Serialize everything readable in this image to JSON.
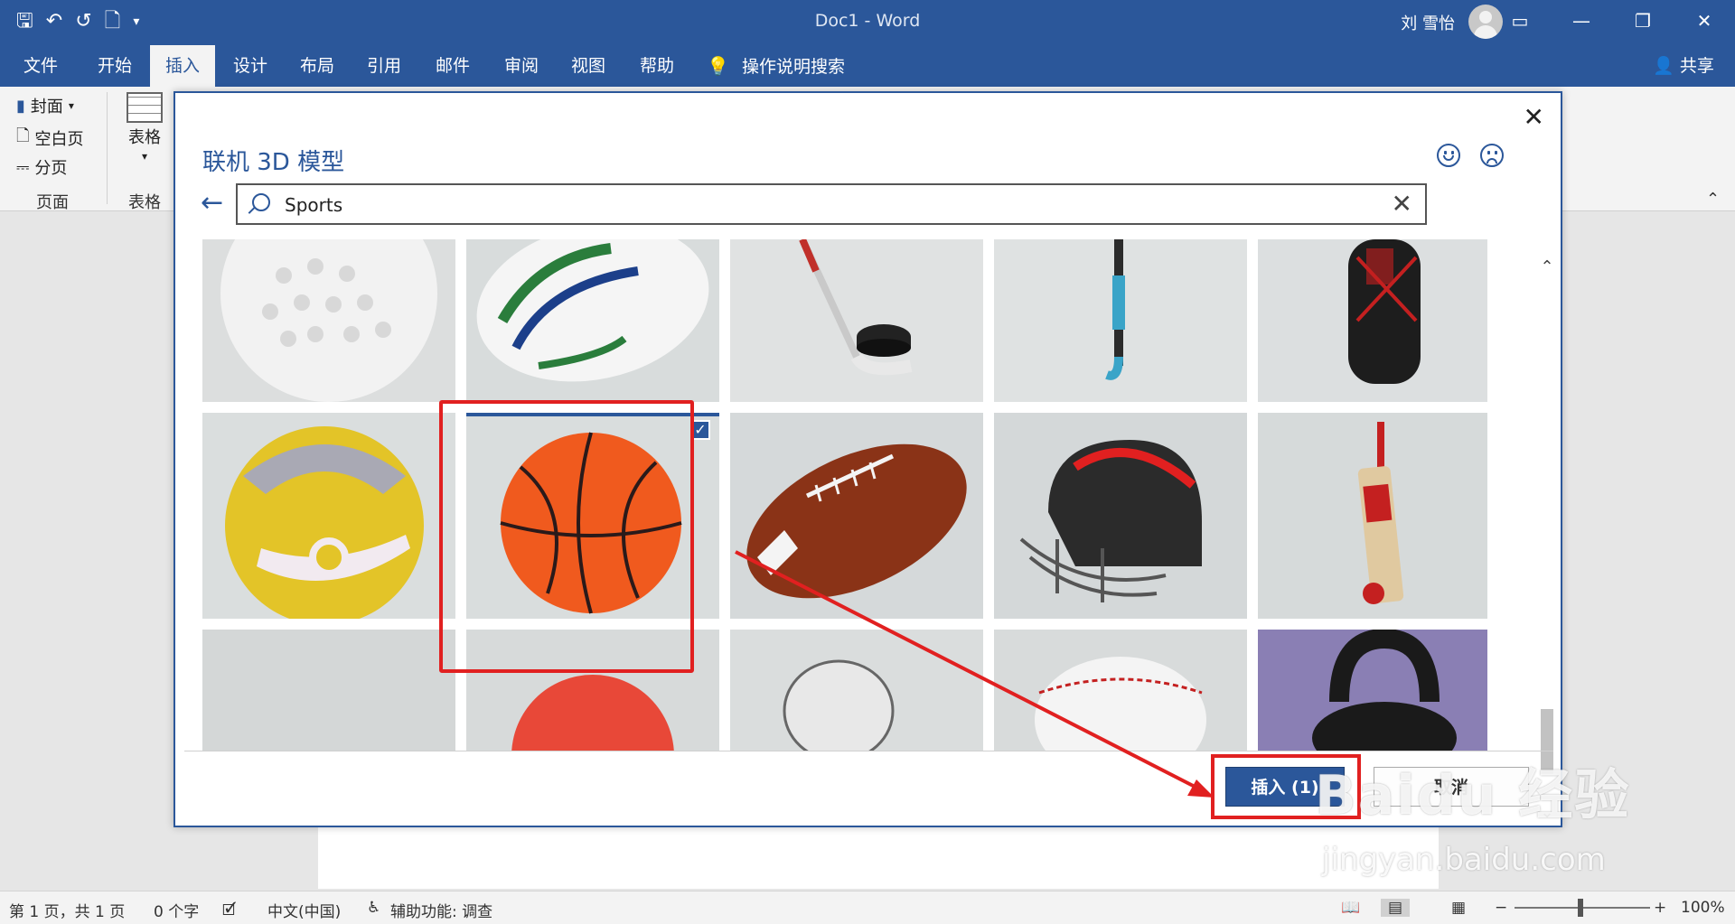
{
  "window": {
    "doc_title": "Doc1  -  Word",
    "user_name": "刘 雪怡"
  },
  "tabs": [
    "文件",
    "开始",
    "插入",
    "设计",
    "布局",
    "引用",
    "邮件",
    "审阅",
    "视图",
    "帮助"
  ],
  "tell_me": "操作说明搜索",
  "share_label": "共享",
  "ribbon": {
    "cover": "封面",
    "blank": "空白页",
    "break": "分页",
    "group_pages": "页面",
    "table": "表格",
    "group_table": "表格"
  },
  "dialog": {
    "title": "联机 3D 模型",
    "search_value": "Sports",
    "insert_label": "插入 (1)",
    "cancel_label": "取消",
    "tiles": [
      "golf-ball",
      "rugby-ball",
      "hockey-stick-puck",
      "field-hockey-stick",
      "golf-bag",
      "volleyball",
      "basketball",
      "american-football",
      "football-helmet",
      "cricket-bat",
      "tile-gray",
      "red-ball",
      "net-racket",
      "baseball",
      "kettlebell"
    ],
    "selected_tile": "basketball"
  },
  "status": {
    "page": "第 1 页，共 1 页",
    "words": "0 个字",
    "lang": "中文(中国)",
    "accessibility": "辅助功能: 调查",
    "zoom": "100%"
  },
  "watermark": {
    "line1": "Baidu 经验",
    "line2": "jingyan.baidu.com"
  },
  "colors": {
    "word_blue": "#2b579a",
    "highlight_red": "#e12020"
  }
}
